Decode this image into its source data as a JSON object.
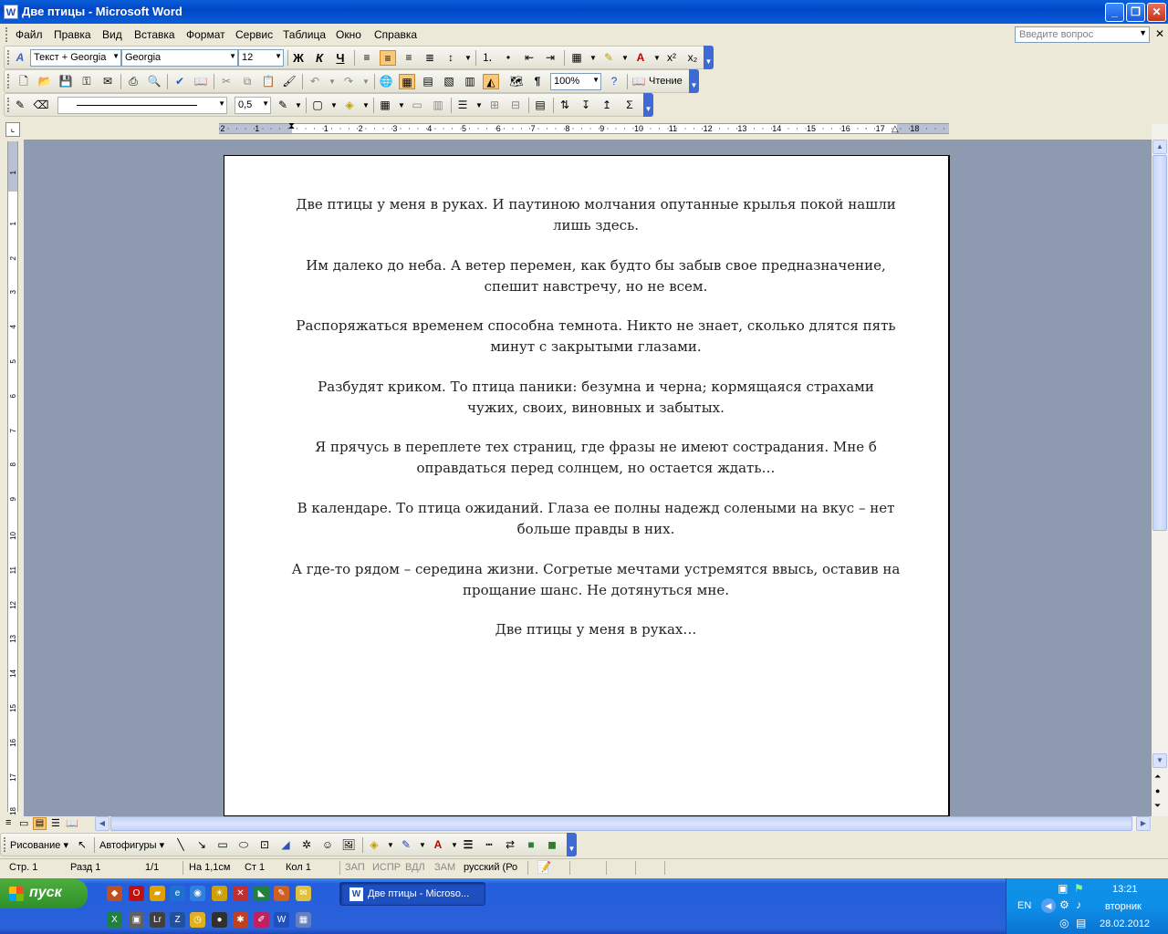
{
  "window": {
    "title": "Две птицы - Microsoft Word",
    "icon": "word-icon",
    "controls": [
      "minimize",
      "maximize",
      "close"
    ]
  },
  "menu": {
    "items": [
      "Файл",
      "Правка",
      "Вид",
      "Вставка",
      "Формат",
      "Сервис",
      "Таблица",
      "Окно",
      "Справка"
    ],
    "help_placeholder": "Введите вопрос"
  },
  "formatting": {
    "style": "Текст + Georgia",
    "font": "Georgia",
    "size": "12",
    "bold": "Ж",
    "italic": "К",
    "underline": "Ч",
    "active_alignment": "center"
  },
  "standard": {
    "zoom": "100%",
    "reading_label": "Чтение",
    "pilcrow": "¶"
  },
  "tables_borders": {
    "line_weight": "0,5",
    "sigma": "Σ"
  },
  "ruler": {
    "labels": [
      "2",
      "1",
      "1",
      "2",
      "3",
      "4",
      "5",
      "6",
      "7",
      "8",
      "9",
      "10",
      "11",
      "12",
      "13",
      "14",
      "15",
      "16",
      "17",
      "18"
    ],
    "vertical_labels": [
      "1",
      "1",
      "2",
      "3",
      "4",
      "5",
      "6",
      "7",
      "8",
      "9",
      "10",
      "11",
      "12",
      "13",
      "14",
      "15",
      "16",
      "17",
      "18"
    ]
  },
  "document": {
    "paragraphs": [
      "Две птицы у меня в руках. И паутиною молчания опутанные крылья покой нашли лишь здесь.",
      "Им далеко до неба. А ветер перемен, как будто бы забыв свое предназначение, спешит навстречу, но не всем.",
      "Распоряжаться временем способна темнота. Никто не знает, сколько длятся пять минут с закрытыми глазами.",
      "Разбудят криком. То птица паники: безумна и черна; кормящаяся страхами чужих, своих, виновных и забытых.",
      "Я прячусь в переплете тех страниц, где фразы не имеют сострадания. Мне б оправдаться перед солнцем, но остается ждать…",
      "В календаре. То птица ожиданий. Глаза ее полны надежд солеными на вкус – нет больше правды в них.",
      "А где-то рядом – середина жизни. Согретые мечтами устремятся ввысь, оставив на прощание шанс. Не дотянуться мне.",
      "Две птицы у меня в руках…"
    ]
  },
  "drawing": {
    "draw_label": "Рисование",
    "autoshapes_label": "Автофигуры"
  },
  "status": {
    "page": "Стр. 1",
    "section": "Разд  1",
    "pages": "1/1",
    "at": "На  1,1см",
    "line": "Ст  1",
    "col": "Кол  1",
    "rec": "ЗАП",
    "trk": "ИСПР",
    "ext": "ВДЛ",
    "ovr": "ЗАМ",
    "language": "русский (Ро"
  },
  "taskbar": {
    "start_label": "пуск",
    "task_label": "Две птицы - Microso...",
    "lang": "EN",
    "time": "13:21",
    "day": "вторник",
    "date": "28.02.2012"
  }
}
